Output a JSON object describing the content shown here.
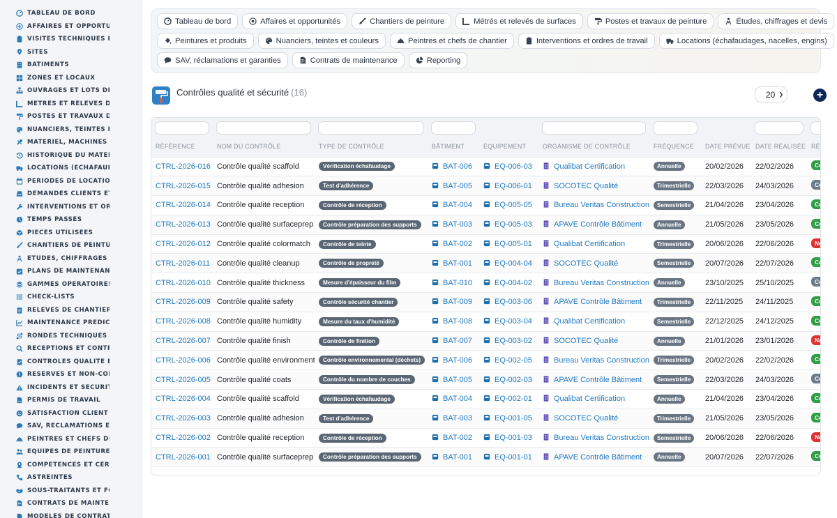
{
  "sidebar": {
    "items": [
      {
        "label": "TABLEAU DE BORD",
        "icon": "dashboard-icon"
      },
      {
        "label": "AFFAIRES ET OPPORTUN",
        "icon": "target-icon"
      },
      {
        "label": "VISITES TECHNIQUES ET",
        "icon": "clipboard-icon"
      },
      {
        "label": "SITES",
        "icon": "map-pin-icon"
      },
      {
        "label": "BÂTIMENTS",
        "icon": "building-icon"
      },
      {
        "label": "ZONES ET LOCAUX",
        "icon": "grid-icon"
      },
      {
        "label": "OUVRAGES ET LOTS DE T",
        "icon": "sitemap-icon"
      },
      {
        "label": "MÉTRÉS ET RELEVÉS DE",
        "icon": "ruler-icon"
      },
      {
        "label": "POSTES ET TRAVAUX DE",
        "icon": "paint-roller-icon"
      },
      {
        "label": "NUANCIERS, TEINTES ET",
        "icon": "palette-icon"
      },
      {
        "label": "MATÉRIEL, MACHINES ET",
        "icon": "tools-icon"
      },
      {
        "label": "HISTORIQUE DU MATÉRI",
        "icon": "history-icon"
      },
      {
        "label": "LOCATIONS (ÉCHAFAUDA",
        "icon": "truck-icon"
      },
      {
        "label": "PÉRIODES DE LOCATION",
        "icon": "calendar-icon"
      },
      {
        "label": "DEMANDES CLIENTS ET I",
        "icon": "inbox-icon"
      },
      {
        "label": "INTERVENTIONS ET ORDI",
        "icon": "wrench-icon"
      },
      {
        "label": "TEMPS PASSÉS",
        "icon": "clock-icon"
      },
      {
        "label": "PIÈCES UTILISÉES",
        "icon": "box-icon"
      },
      {
        "label": "CHANTIERS DE PEINTURI",
        "icon": "brush-icon"
      },
      {
        "label": "ÉTUDES, CHIFFRAGES ET",
        "icon": "calculator-icon"
      },
      {
        "label": "PLANS DE MAINTENANCE",
        "icon": "calendar-check-icon"
      },
      {
        "label": "GAMMES OPÉRATOIRES",
        "icon": "layers-icon"
      },
      {
        "label": "CHECK-LISTS",
        "icon": "list-icon"
      },
      {
        "label": "RELEVÉS DE CHANTIER",
        "icon": "clipboard-list-icon"
      },
      {
        "label": "MAINTENANCE PRÉDICTI",
        "icon": "chart-line-icon"
      },
      {
        "label": "RONDES TECHNIQUES",
        "icon": "route-icon"
      },
      {
        "label": "RÉCEPTIONS ET CONTRÔ",
        "icon": "search-icon"
      },
      {
        "label": "CONTRÔLES QUALITÉ ET",
        "icon": "clipboard-check-icon"
      },
      {
        "label": "RÉSERVES ET NON-CONF",
        "icon": "alert-circle-icon"
      },
      {
        "label": "INCIDENTS ET SÉCURITÉ",
        "icon": "warning-icon"
      },
      {
        "label": "PERMIS DE TRAVAIL",
        "icon": "file-signature-icon"
      },
      {
        "label": "SATISFACTION CLIENT",
        "icon": "smile-icon"
      },
      {
        "label": "SAV, RÉCLAMATIONS ET",
        "icon": "comment-icon"
      },
      {
        "label": "PEINTRES ET CHEFS DE C",
        "icon": "hard-hat-icon"
      },
      {
        "label": "ÉQUIPES DE PEINTURE",
        "icon": "users-icon"
      },
      {
        "label": "COMPÉTENCES ET CERTI",
        "icon": "certificate-icon"
      },
      {
        "label": "ASTREINTES",
        "icon": "phone-icon"
      },
      {
        "label": "SOUS-TRAITANTS ET FOU",
        "icon": "handshake-icon"
      },
      {
        "label": "CONTRATS DE MAINTENA",
        "icon": "file-contract-icon"
      },
      {
        "label": "MODÈLES DE CONTRATS",
        "icon": "file-icon"
      }
    ]
  },
  "nav_panel": {
    "rows": [
      [
        {
          "label": "Tableau de bord",
          "icon": "dashboard-icon"
        },
        {
          "label": "Affaires et opportunités",
          "icon": "target-icon"
        },
        {
          "label": "Chantiers de peinture",
          "icon": "brush-icon"
        },
        {
          "label": "Métrés et relevés de surfaces",
          "icon": "ruler-icon"
        },
        {
          "label": "Postes et travaux de peinture",
          "icon": "paint-roller-icon"
        },
        {
          "label": "Études, chiffrages et devis",
          "icon": "calculator-icon"
        }
      ],
      [
        {
          "label": "Peintures et produits",
          "icon": "fill-icon"
        },
        {
          "label": "Nuanciers, teintes et couleurs",
          "icon": "palette-icon"
        },
        {
          "label": "Peintres et chefs de chantier",
          "icon": "hard-hat-icon"
        },
        {
          "label": "Interventions et ordres de travail",
          "icon": "clipboard-icon"
        },
        {
          "label": "Locations (échafaudages, nacelles, engins)",
          "icon": "truck-icon"
        }
      ],
      [
        {
          "label": "SAV, réclamations et garanties",
          "icon": "comment-icon"
        },
        {
          "label": "Contrats de maintenance",
          "icon": "file-contract-icon"
        },
        {
          "label": "Reporting",
          "icon": "pie-chart-icon"
        }
      ]
    ]
  },
  "page": {
    "title": "Contrôles qualité et sécurité",
    "count": "(16)",
    "page_size": "20",
    "accent": "#0d2557"
  },
  "table": {
    "headers": [
      "RÉFÉRENCE",
      "NOM DU CONTRÔLE",
      "TYPE DE CONTRÔLE",
      "BÂTIMENT",
      "ÉQUIPEMENT",
      "ORGANISME DE CONTRÔLE",
      "FRÉQUENCE",
      "DATE PRÉVUE",
      "DATE RÉALISÉE",
      "RÉS"
    ],
    "rows": [
      {
        "ref": "CTRL-2026-016",
        "name": "Contrôle qualité scaffold",
        "type": "Vérification échafaudage",
        "bat": "BAT-006",
        "eq": "EQ-006-03",
        "org": "Qualibat Certification",
        "freq": "Annuelle",
        "prevue": "20/02/2026",
        "realisee": "22/02/2026",
        "res": "Co",
        "res_color": "#2f9e44"
      },
      {
        "ref": "CTRL-2026-015",
        "name": "Contrôle qualité adhesion",
        "type": "Test d'adhérence",
        "bat": "BAT-005",
        "eq": "EQ-006-01",
        "org": "SOCOTEC Qualité",
        "freq": "Trimestrielle",
        "prevue": "22/03/2026",
        "realisee": "24/03/2026",
        "res": "Co",
        "res_color": "#6c7a89"
      },
      {
        "ref": "CTRL-2026-014",
        "name": "Contrôle qualité reception",
        "type": "Contrôle de réception",
        "bat": "BAT-004",
        "eq": "EQ-005-05",
        "org": "Bureau Veritas Construction",
        "freq": "Semestrielle",
        "prevue": "21/04/2026",
        "realisee": "23/04/2026",
        "res": "Co",
        "res_color": "#2f9e44"
      },
      {
        "ref": "CTRL-2026-013",
        "name": "Contrôle qualité surfaceprep",
        "type": "Contrôle préparation des supports",
        "bat": "BAT-003",
        "eq": "EQ-005-03",
        "org": "APAVE Contrôle Bâtiment",
        "freq": "Annuelle",
        "prevue": "21/05/2026",
        "realisee": "23/05/2026",
        "res": "Co",
        "res_color": "#2f9e44"
      },
      {
        "ref": "CTRL-2026-012",
        "name": "Contrôle qualité colormatch",
        "type": "Contrôle de teinte",
        "bat": "BAT-002",
        "eq": "EQ-005-01",
        "org": "Qualibat Certification",
        "freq": "Trimestrielle",
        "prevue": "20/06/2026",
        "realisee": "22/06/2026",
        "res": "No",
        "res_color": "#e03131"
      },
      {
        "ref": "CTRL-2026-011",
        "name": "Contrôle qualité cleanup",
        "type": "Contrôle de propreté",
        "bat": "BAT-001",
        "eq": "EQ-004-04",
        "org": "SOCOTEC Qualité",
        "freq": "Semestrielle",
        "prevue": "20/07/2026",
        "realisee": "22/07/2026",
        "res": "Co",
        "res_color": "#2f9e44"
      },
      {
        "ref": "CTRL-2026-010",
        "name": "Contrôle qualité thickness",
        "type": "Mesure d'épaisseur du film",
        "bat": "BAT-010",
        "eq": "EQ-004-02",
        "org": "Bureau Veritas Construction",
        "freq": "Annuelle",
        "prevue": "23/10/2025",
        "realisee": "25/10/2025",
        "res": "Co",
        "res_color": "#6c7a89"
      },
      {
        "ref": "CTRL-2026-009",
        "name": "Contrôle qualité safety",
        "type": "Contrôle sécurité chantier",
        "bat": "BAT-009",
        "eq": "EQ-003-06",
        "org": "APAVE Contrôle Bâtiment",
        "freq": "Trimestrielle",
        "prevue": "22/11/2025",
        "realisee": "24/11/2025",
        "res": "Co",
        "res_color": "#2f9e44"
      },
      {
        "ref": "CTRL-2026-008",
        "name": "Contrôle qualité humidity",
        "type": "Mesure du taux d'humidité",
        "bat": "BAT-008",
        "eq": "EQ-003-04",
        "org": "Qualibat Certification",
        "freq": "Semestrielle",
        "prevue": "22/12/2025",
        "realisee": "24/12/2025",
        "res": "Co",
        "res_color": "#2f9e44"
      },
      {
        "ref": "CTRL-2026-007",
        "name": "Contrôle qualité finish",
        "type": "Contrôle de finition",
        "bat": "BAT-007",
        "eq": "EQ-003-02",
        "org": "SOCOTEC Qualité",
        "freq": "Annuelle",
        "prevue": "21/01/2026",
        "realisee": "23/01/2026",
        "res": "No",
        "res_color": "#e03131"
      },
      {
        "ref": "CTRL-2026-006",
        "name": "Contrôle qualité environment",
        "type": "Contrôle environnemental (déchets)",
        "bat": "BAT-006",
        "eq": "EQ-002-05",
        "org": "Bureau Veritas Construction",
        "freq": "Trimestrielle",
        "prevue": "20/02/2026",
        "realisee": "22/02/2026",
        "res": "Co",
        "res_color": "#2f9e44"
      },
      {
        "ref": "CTRL-2026-005",
        "name": "Contrôle qualité coats",
        "type": "Contrôle du nombre de couches",
        "bat": "BAT-005",
        "eq": "EQ-002-03",
        "org": "APAVE Contrôle Bâtiment",
        "freq": "Semestrielle",
        "prevue": "22/03/2026",
        "realisee": "24/03/2026",
        "res": "Co",
        "res_color": "#6c7a89"
      },
      {
        "ref": "CTRL-2026-004",
        "name": "Contrôle qualité scaffold",
        "type": "Vérification échafaudage",
        "bat": "BAT-004",
        "eq": "EQ-002-01",
        "org": "Qualibat Certification",
        "freq": "Annuelle",
        "prevue": "21/04/2026",
        "realisee": "23/04/2026",
        "res": "Co",
        "res_color": "#2f9e44"
      },
      {
        "ref": "CTRL-2026-003",
        "name": "Contrôle qualité adhesion",
        "type": "Test d'adhérence",
        "bat": "BAT-003",
        "eq": "EQ-001-05",
        "org": "SOCOTEC Qualité",
        "freq": "Trimestrielle",
        "prevue": "21/05/2026",
        "realisee": "23/05/2026",
        "res": "Co",
        "res_color": "#2f9e44"
      },
      {
        "ref": "CTRL-2026-002",
        "name": "Contrôle qualité reception",
        "type": "Contrôle de réception",
        "bat": "BAT-002",
        "eq": "EQ-001-03",
        "org": "Bureau Veritas Construction",
        "freq": "Semestrielle",
        "prevue": "20/06/2026",
        "realisee": "22/06/2026",
        "res": "No",
        "res_color": "#e03131"
      },
      {
        "ref": "CTRL-2026-001",
        "name": "Contrôle qualité surfaceprep",
        "type": "Contrôle préparation des supports",
        "bat": "BAT-001",
        "eq": "EQ-001-01",
        "org": "APAVE Contrôle Bâtiment",
        "freq": "Annuelle",
        "prevue": "20/07/2026",
        "realisee": "22/07/2026",
        "res": "Co",
        "res_color": "#2f9e44"
      }
    ]
  }
}
